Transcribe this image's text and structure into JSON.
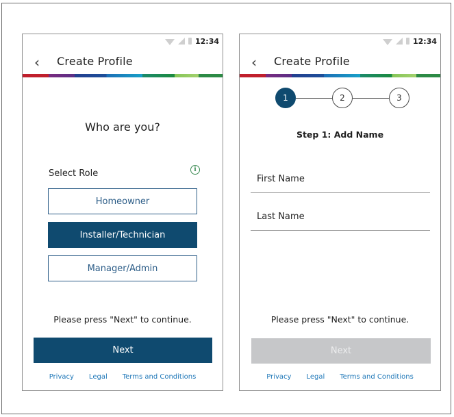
{
  "status_bar": {
    "time": "12:34"
  },
  "left_screen": {
    "header_title": "Create Profile",
    "question": "Who are you?",
    "select_role_label": "Select Role",
    "info_icon_glyph": "i",
    "roles": [
      {
        "label": "Homeowner",
        "selected": false
      },
      {
        "label": "Installer/Technician",
        "selected": true
      },
      {
        "label": "Manager/Admin",
        "selected": false
      }
    ],
    "hint": "Please press \"Next\" to continue.",
    "next_label": "Next",
    "footer": {
      "privacy": "Privacy",
      "legal": "Legal",
      "terms": "Terms and Conditions"
    }
  },
  "right_screen": {
    "header_title": "Create Profile",
    "steps": [
      "1",
      "2",
      "3"
    ],
    "active_step": 1,
    "step_title": "Step 1: Add Name",
    "fields": {
      "first_name_label": "First Name",
      "last_name_label": "Last Name"
    },
    "hint": "Please press \"Next\" to continue.",
    "next_label": "Next",
    "next_enabled": false,
    "footer": {
      "privacy": "Privacy",
      "legal": "Legal",
      "terms": "Terms and Conditions"
    }
  },
  "colors": {
    "primary": "#0f4a6f",
    "outline": "#2a5b86",
    "disabled": "#c6c7c9",
    "link": "#1e77b8",
    "info": "#3a8a52"
  },
  "icons": {
    "back": "chevron-left-icon",
    "wifi": "wifi-icon",
    "signal": "signal-icon",
    "battery": "battery-icon",
    "info": "info-icon"
  }
}
